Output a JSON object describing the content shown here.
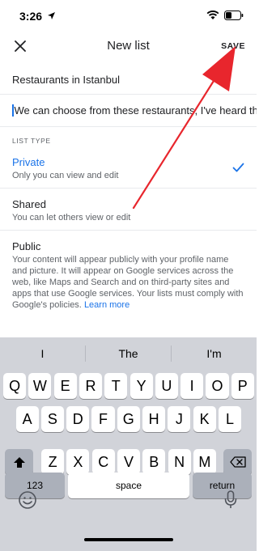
{
  "status_bar": {
    "time": "3:26"
  },
  "app_bar": {
    "title": "New list",
    "save_label": "SAVE"
  },
  "form": {
    "name_value": "Restaurants in Istanbul",
    "description_value": "We can choose from these restaurants, I've heard the"
  },
  "list_type": {
    "section_label": "LIST TYPE",
    "options": [
      {
        "title": "Private",
        "subtitle": "Only you can view and edit",
        "selected": true
      },
      {
        "title": "Shared",
        "subtitle": "You can let others view or edit",
        "selected": false
      },
      {
        "title": "Public",
        "subtitle": "Your content will appear publicly with your profile name and picture. It will appear on Google services across the web, like Maps and Search and on third-party sites and apps that use Google services. Your lists must comply with Google's policies.",
        "link": "Learn more",
        "selected": false
      }
    ]
  },
  "keyboard": {
    "suggestions": [
      "I",
      "The",
      "I'm"
    ],
    "row1": [
      "Q",
      "W",
      "E",
      "R",
      "T",
      "Y",
      "U",
      "I",
      "O",
      "P"
    ],
    "row2": [
      "A",
      "S",
      "D",
      "F",
      "G",
      "H",
      "J",
      "K",
      "L"
    ],
    "row3": [
      "Z",
      "X",
      "C",
      "V",
      "B",
      "N",
      "M"
    ],
    "numbers_label": "123",
    "space_label": "space",
    "return_label": "return"
  },
  "colors": {
    "accent": "#1a73e8",
    "annotation_arrow": "#e8262d",
    "keyboard_bg": "#d1d3d9"
  }
}
